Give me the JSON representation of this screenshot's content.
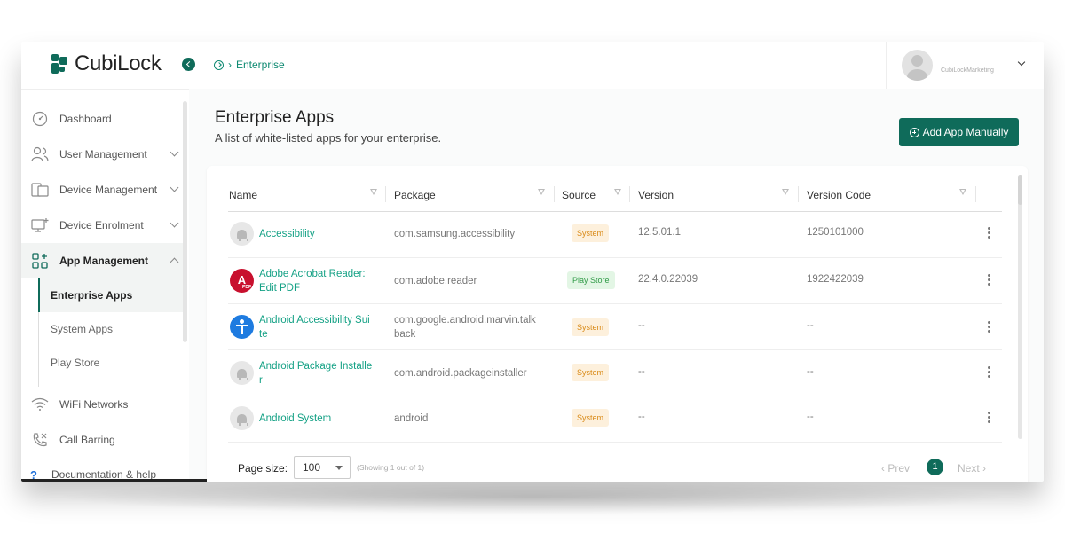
{
  "brand": {
    "name_part1": "Cubi",
    "name_part2": "Lock"
  },
  "breadcrumb": {
    "current": "Enterprise"
  },
  "user": {
    "name": "CubiLockMarketing"
  },
  "sidebar": {
    "items": [
      {
        "label": "Dashboard",
        "icon": "dashboard-icon"
      },
      {
        "label": "User Management",
        "icon": "users-icon"
      },
      {
        "label": "Device Management",
        "icon": "devices-icon"
      },
      {
        "label": "Device Enrolment",
        "icon": "monitor-plus-icon"
      },
      {
        "label": "App Management",
        "icon": "apps-grid-icon"
      },
      {
        "label": "WiFi Networks",
        "icon": "wifi-icon"
      },
      {
        "label": "Call Barring",
        "icon": "phone-barred-icon"
      }
    ],
    "app_sub": [
      {
        "label": "Enterprise Apps"
      },
      {
        "label": "System Apps"
      },
      {
        "label": "Play Store"
      }
    ],
    "docs_label": "Documentation & help"
  },
  "page": {
    "title": "Enterprise Apps",
    "subtitle": "A list of white-listed apps for your enterprise.",
    "add_button": "Add App Manually"
  },
  "table": {
    "columns": [
      "Name",
      "Package",
      "Source",
      "Version",
      "Version Code"
    ],
    "rows": [
      {
        "name_l1": "Accessibility",
        "name_l2": "",
        "icon": "android-icon",
        "pkg_l1": "com.samsung.accessibility",
        "pkg_l2": "",
        "source": "System",
        "version": "12.5.01.1",
        "code": "1250101000"
      },
      {
        "name_l1": "Adobe Acrobat Reader:",
        "name_l2": "Edit PDF",
        "icon": "adobe-pdf-icon",
        "pkg_l1": "com.adobe.reader",
        "pkg_l2": "",
        "source": "Play Store",
        "version": "22.4.0.22039",
        "code": "1922422039"
      },
      {
        "name_l1": "Android Accessibility Sui",
        "name_l2": "te",
        "icon": "accessibility-icon",
        "pkg_l1": "com.google.android.marvin.talk",
        "pkg_l2": "back",
        "source": "System",
        "version": "--",
        "code": "--"
      },
      {
        "name_l1": "Android Package Installe",
        "name_l2": "r",
        "icon": "android-icon",
        "pkg_l1": "com.android.packageinstaller",
        "pkg_l2": "",
        "source": "System",
        "version": "--",
        "code": "--"
      },
      {
        "name_l1": "Android System",
        "name_l2": "",
        "icon": "android-icon",
        "pkg_l1": "android",
        "pkg_l2": "",
        "source": "System",
        "version": "--",
        "code": "--"
      }
    ]
  },
  "pagination": {
    "page_size_label": "Page size:",
    "page_size": "100",
    "showing": "(Showing 1 out of 1)",
    "prev": "Prev",
    "page": "1",
    "next": "Next"
  },
  "colors": {
    "brand": "#0f6b5a",
    "link": "#14a185",
    "system_badge": "#d98a17",
    "play_badge": "#2f9a46"
  }
}
